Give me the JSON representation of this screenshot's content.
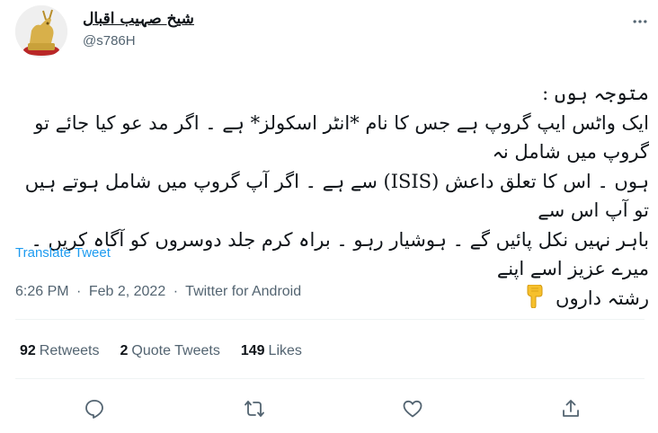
{
  "author": {
    "display_name": "شیخ صہیب اقبال",
    "handle": "@s786H",
    "avatar_icon": "golden-trophy-avatar"
  },
  "tweet": {
    "lines": [
      "متوجہ ہوں :",
      "ایک واٹس ایپ گروپ ہے جس کا نام *انٹر اسکولز* ہے ۔ اگر مد عو کیا جائے تو گروپ میں شامل نہ",
      "ہوں ۔ اس کا تعلق داعش (ISIS) سے ہے ۔ اگر آپ گروپ میں شامل ہوتے ہیں تو آپ اس سے",
      "باہر نہیں نکل پائیں گے ۔ ہوشیار رہو ۔ براہ کرم جلد دوسروں کو آگاہ کریں ۔ میرے عزیز اسے اپنے",
      "رشتہ داروں"
    ],
    "emoji": "👇",
    "translate_label": "Translate Tweet"
  },
  "meta": {
    "time": "6:26 PM",
    "date": "Feb 2, 2022",
    "source": "Twitter for Android",
    "separator": "·"
  },
  "stats": {
    "retweets_count": "92",
    "retweets_label": "Retweets",
    "quotes_count": "2",
    "quotes_label": "Quote Tweets",
    "likes_count": "149",
    "likes_label": "Likes"
  },
  "actions": [
    "reply-icon",
    "retweet-icon",
    "like-icon",
    "share-icon"
  ],
  "colors": {
    "text": "#0f1419",
    "secondary": "#536471",
    "link": "#1d9bf0",
    "emoji": "#f6c02c",
    "divider": "#eff3f4"
  }
}
